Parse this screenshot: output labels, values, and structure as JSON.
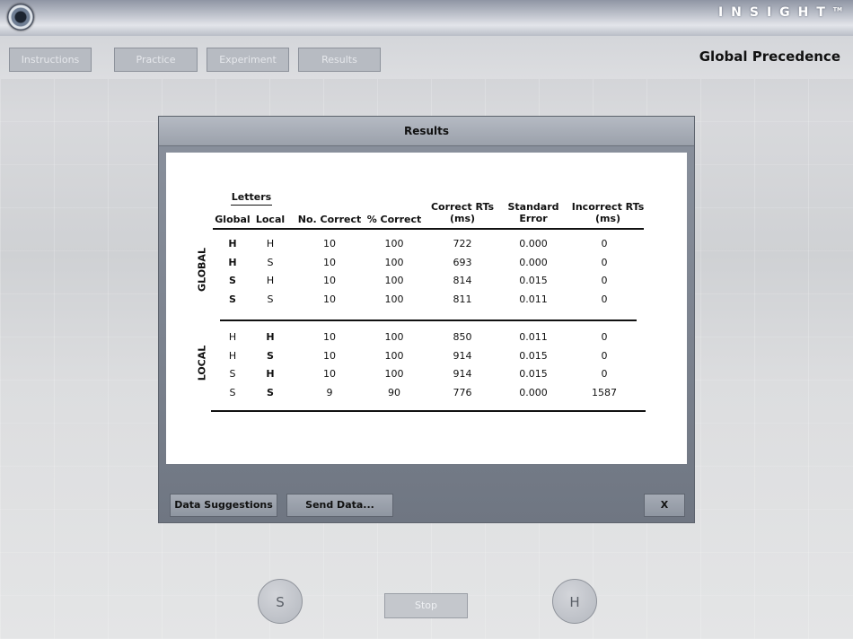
{
  "app": {
    "brand": "INSIGHT",
    "brand_mark": "TM",
    "page_title": "Global Precedence"
  },
  "nav": {
    "tabs": [
      {
        "label": "Instructions"
      },
      {
        "label": "Practice"
      },
      {
        "label": "Experiment"
      },
      {
        "label": "Results"
      }
    ]
  },
  "dialog": {
    "title": "Results",
    "buttons": {
      "suggestions": "Data Suggestions",
      "send": "Send Data...",
      "close": "X"
    }
  },
  "results_table": {
    "group_header": "Letters",
    "columns": {
      "global": "Global",
      "local": "Local",
      "no_correct": "No. Correct",
      "pct_correct": "% Correct",
      "correct_rts_1": "Correct RTs",
      "correct_rts_2": "(ms)",
      "std_err_1": "Standard",
      "std_err_2": "Error",
      "incorrect_rts_1": "Incorrect RTs",
      "incorrect_rts_2": "(ms)"
    },
    "sections": [
      {
        "label": "GLOBAL",
        "rows": [
          {
            "global": "H",
            "local": "H",
            "no_correct": "10",
            "pct_correct": "100",
            "correct_rt": "722",
            "std_err": "0.000",
            "incorrect_rt": "0"
          },
          {
            "global": "H",
            "local": "S",
            "no_correct": "10",
            "pct_correct": "100",
            "correct_rt": "693",
            "std_err": "0.000",
            "incorrect_rt": "0"
          },
          {
            "global": "S",
            "local": "H",
            "no_correct": "10",
            "pct_correct": "100",
            "correct_rt": "814",
            "std_err": "0.015",
            "incorrect_rt": "0"
          },
          {
            "global": "S",
            "local": "S",
            "no_correct": "10",
            "pct_correct": "100",
            "correct_rt": "811",
            "std_err": "0.011",
            "incorrect_rt": "0"
          }
        ]
      },
      {
        "label": "LOCAL",
        "rows": [
          {
            "global": "H",
            "local": "H",
            "no_correct": "10",
            "pct_correct": "100",
            "correct_rt": "850",
            "std_err": "0.011",
            "incorrect_rt": "0"
          },
          {
            "global": "H",
            "local": "S",
            "no_correct": "10",
            "pct_correct": "100",
            "correct_rt": "914",
            "std_err": "0.015",
            "incorrect_rt": "0"
          },
          {
            "global": "S",
            "local": "H",
            "no_correct": "10",
            "pct_correct": "100",
            "correct_rt": "914",
            "std_err": "0.015",
            "incorrect_rt": "0"
          },
          {
            "global": "S",
            "local": "S",
            "no_correct": "9",
            "pct_correct": "90",
            "correct_rt": "776",
            "std_err": "0.000",
            "incorrect_rt": "1587"
          }
        ]
      }
    ]
  },
  "controls": {
    "left_key": "S",
    "right_key": "H",
    "stop": "Stop"
  }
}
